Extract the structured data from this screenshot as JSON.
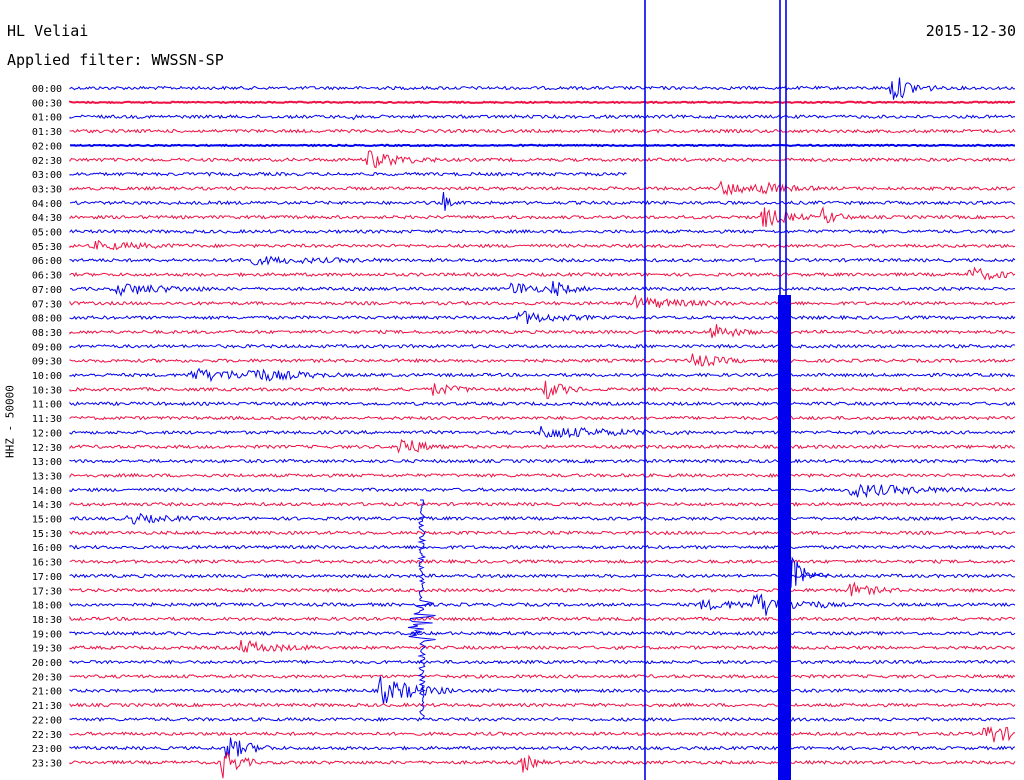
{
  "header": {
    "station": "HL Veliai",
    "filter": "Applied filter: WWSSN-SP",
    "date": "2015-12-30"
  },
  "chart_data": {
    "type": "line",
    "title": "HL Veliai",
    "date": "2015-12-30",
    "filter": "WWSSN-SP",
    "ylabel": "HHZ - 50000",
    "row_labels": [
      "00:00",
      "00:30",
      "01:00",
      "01:30",
      "02:00",
      "02:30",
      "03:00",
      "03:30",
      "04:00",
      "04:30",
      "05:00",
      "05:30",
      "06:00",
      "06:30",
      "07:00",
      "07:30",
      "08:00",
      "08:30",
      "09:00",
      "09:30",
      "10:00",
      "10:30",
      "11:00",
      "11:30",
      "12:00",
      "12:30",
      "13:00",
      "13:30",
      "14:00",
      "14:30",
      "15:00",
      "15:30",
      "16:00",
      "16:30",
      "17:00",
      "17:30",
      "18:00",
      "18:30",
      "19:00",
      "19:30",
      "20:00",
      "20:30",
      "21:00",
      "21:30",
      "22:00",
      "22:30",
      "23:00",
      "23:30"
    ],
    "series_colors": [
      "#0000ee",
      "#ee1144"
    ],
    "grid": false
  }
}
